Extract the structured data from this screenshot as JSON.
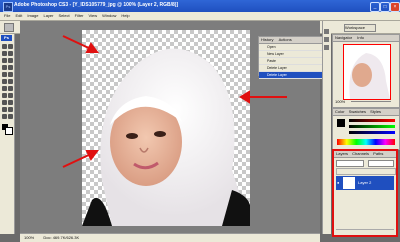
{
  "window": {
    "title": "Adobe Photoshop CS3 - [Y_IDS105779_jpg @ 100% (Layer 2, RGB/8)]",
    "app_badge": "Ps"
  },
  "menu": [
    "File",
    "Edit",
    "Image",
    "Layer",
    "Select",
    "Filter",
    "View",
    "Window",
    "Help"
  ],
  "options": {
    "feather_label": "Feather:",
    "feather_value": "0 px",
    "antialias_label": "Anti-alias",
    "style_label": "Style:",
    "style_value": "Normal",
    "width_label": "Width:",
    "height_label": "Height:",
    "refine_label": "Refine Edge...",
    "workspace_label": "Workspace"
  },
  "tools_badge": "Ps",
  "history": {
    "tab": "History",
    "actions_tab": "Actions",
    "items": [
      "Open",
      "New Layer",
      "Paste",
      "Delete Layer",
      "Delete Layer"
    ]
  },
  "navigator": {
    "tab": "Navigator",
    "info_tab": "Info",
    "zoom": "100%"
  },
  "color_panel": {
    "tabs": [
      "Color",
      "Swatches",
      "Styles"
    ]
  },
  "layers_panel": {
    "tabs": [
      "Layers",
      "Channels",
      "Paths"
    ],
    "layer_name": "Layer 2"
  },
  "status": {
    "zoom": "100%",
    "doc": "Doc: 469.7K/626.3K"
  },
  "colors": {
    "title_bar": "#1f4fbf",
    "panel_bg": "#ece9d8",
    "arrow": "#e01010",
    "highlight": "#e01010"
  }
}
